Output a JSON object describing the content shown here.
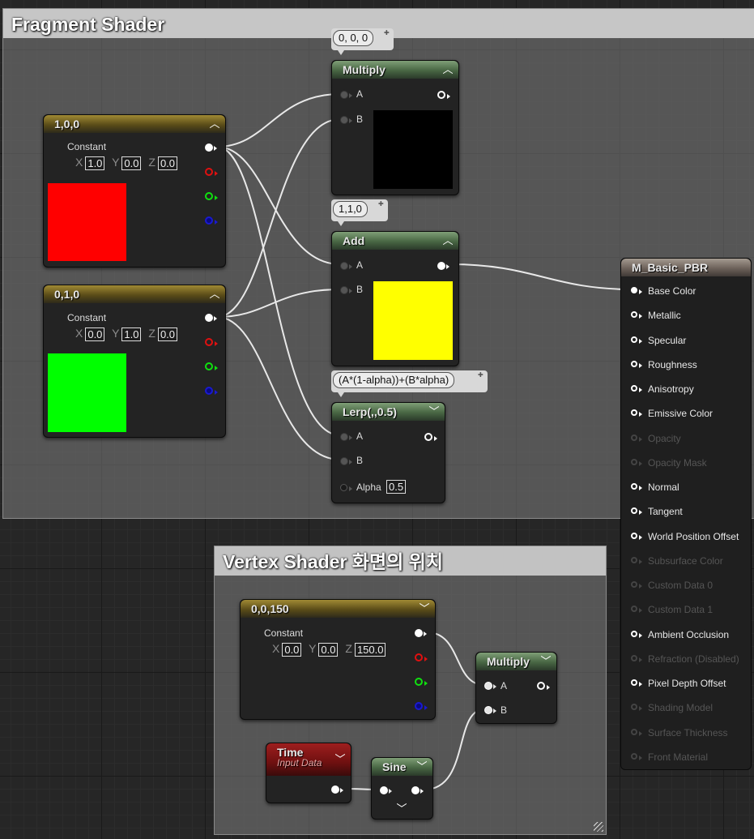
{
  "comments": {
    "fragment": {
      "title": "Fragment Shader"
    },
    "vertex": {
      "title": "Vertex Shader 화면의 위치"
    }
  },
  "constant_label": "Constant",
  "axes": {
    "x": "X",
    "y": "Y",
    "z": "Z"
  },
  "nodes": {
    "const_red": {
      "title": "1,0,0",
      "x": "1.0",
      "y": "0.0",
      "z": "0.0",
      "preview_color": "#ff0000"
    },
    "const_green": {
      "title": "0,1,0",
      "x": "0.0",
      "y": "1.0",
      "z": "0.0",
      "preview_color": "#00ff00"
    },
    "multiply_top": {
      "title": "Multiply",
      "pin_a": "A",
      "pin_b": "B",
      "preview_color": "#000000",
      "tooltip": "0, 0, 0"
    },
    "add": {
      "title": "Add",
      "pin_a": "A",
      "pin_b": "B",
      "preview_color": "#ffff00",
      "tooltip": "1,1,0"
    },
    "lerp": {
      "title": "Lerp(,,0.5)",
      "pin_a": "A",
      "pin_b": "B",
      "pin_alpha": "Alpha",
      "alpha_value": "0.5",
      "tooltip": "(A*(1-alpha))+(B*alpha)"
    },
    "const_vertex": {
      "title": "0,0,150",
      "x": "0.0",
      "y": "0.0",
      "z": "150.0"
    },
    "multiply_vertex": {
      "title": "Multiply",
      "pin_a": "A",
      "pin_b": "B"
    },
    "time": {
      "title": "Time",
      "subtitle": "Input Data"
    },
    "sine": {
      "title": "Sine"
    }
  },
  "material": {
    "title": "M_Basic_PBR",
    "inputs": [
      {
        "label": "Base Color",
        "enabled": true,
        "connected": true
      },
      {
        "label": "Metallic",
        "enabled": true,
        "connected": false
      },
      {
        "label": "Specular",
        "enabled": true,
        "connected": false
      },
      {
        "label": "Roughness",
        "enabled": true,
        "connected": false
      },
      {
        "label": "Anisotropy",
        "enabled": true,
        "connected": false
      },
      {
        "label": "Emissive Color",
        "enabled": true,
        "connected": false
      },
      {
        "label": "Opacity",
        "enabled": false,
        "connected": false
      },
      {
        "label": "Opacity Mask",
        "enabled": false,
        "connected": false
      },
      {
        "label": "Normal",
        "enabled": true,
        "connected": false
      },
      {
        "label": "Tangent",
        "enabled": true,
        "connected": false
      },
      {
        "label": "World Position Offset",
        "enabled": true,
        "connected": false
      },
      {
        "label": "Subsurface Color",
        "enabled": false,
        "connected": false
      },
      {
        "label": "Custom Data 0",
        "enabled": false,
        "connected": false
      },
      {
        "label": "Custom Data 1",
        "enabled": false,
        "connected": false
      },
      {
        "label": "Ambient Occlusion",
        "enabled": true,
        "connected": false
      },
      {
        "label": "Refraction (Disabled)",
        "enabled": false,
        "connected": false
      },
      {
        "label": "Pixel Depth Offset",
        "enabled": true,
        "connected": false
      },
      {
        "label": "Shading Model",
        "enabled": false,
        "connected": false
      },
      {
        "label": "Surface Thickness",
        "enabled": false,
        "connected": false
      },
      {
        "label": "Front Material",
        "enabled": false,
        "connected": false
      }
    ]
  },
  "colors": {
    "wire": "#e8e8e8",
    "disabled_text": "#555555"
  }
}
